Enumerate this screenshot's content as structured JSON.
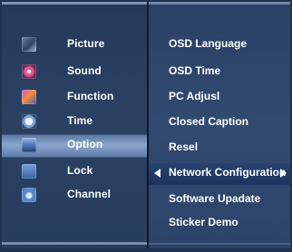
{
  "menu": {
    "categories": [
      {
        "label": "Picture",
        "icon": "picture-icon"
      },
      {
        "label": "Sound",
        "icon": "sound-icon"
      },
      {
        "label": "Function",
        "icon": "function-icon"
      },
      {
        "label": "Time",
        "icon": "time-icon"
      },
      {
        "label": "Option",
        "icon": "option-icon"
      },
      {
        "label": "Lock",
        "icon": "lock-icon"
      },
      {
        "label": "Channel",
        "icon": "channel-icon"
      }
    ],
    "selected_category": "Option",
    "options": [
      {
        "label": "OSD Language"
      },
      {
        "label": "OSD Time"
      },
      {
        "label": "PC Adjusl"
      },
      {
        "label": "Closed Caption"
      },
      {
        "label": "Resel"
      },
      {
        "label": "Network Configuration"
      },
      {
        "label": "Software Upadate"
      },
      {
        "label": "Sticker Demo"
      }
    ],
    "highlighted_option": "Network Configuration"
  },
  "colors": {
    "panel_bg": "#2a4163",
    "selected_bar": "#8ba6cc",
    "text": "#ffffff"
  }
}
